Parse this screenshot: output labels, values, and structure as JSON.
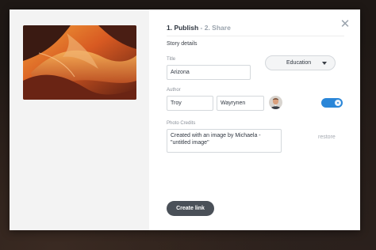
{
  "stepper": {
    "step1": "1. Publish",
    "separator": " - ",
    "step2": "2. Share"
  },
  "close_icon": "close-icon",
  "form": {
    "section_title": "Story details",
    "title_label": "Title",
    "title_value": "Arizona",
    "category_value": "Education",
    "author_label": "Author",
    "author_first": "Troy",
    "author_last": "Wayrynen",
    "author_toggle_on": true,
    "credits_label": "Photo Credits",
    "credits_value": "Created with an image by Michaela - \"untitled image\"",
    "restore_label": "restore"
  },
  "actions": {
    "create_link_label": "Create link"
  },
  "colors": {
    "accent": "#2a86d8",
    "primary_button": "#4a5058",
    "muted_text": "#9aa3ad"
  }
}
